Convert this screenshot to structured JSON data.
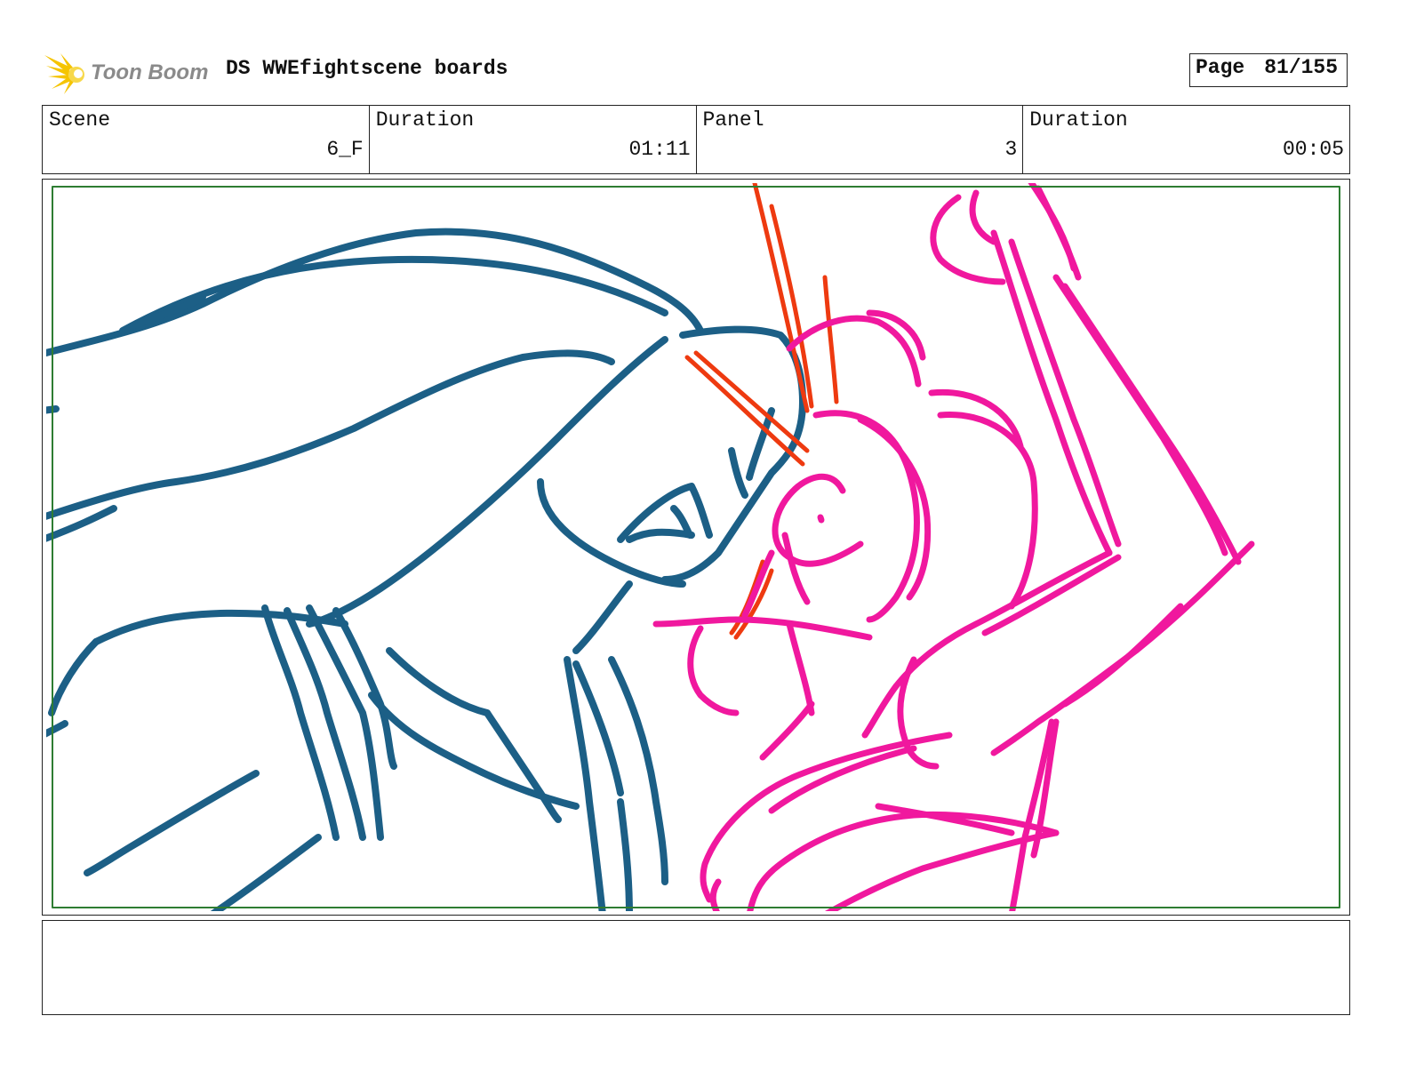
{
  "header": {
    "logo_text": "Toon Boom",
    "board_title": "DS WWEfightscene boards",
    "page_label": "Page",
    "page_value": "81/155"
  },
  "info": {
    "scene_label": "Scene",
    "scene_value": "6_F",
    "scene_duration_label": "Duration",
    "scene_duration_value": "01:11",
    "panel_label": "Panel",
    "panel_value": "3",
    "panel_duration_label": "Duration",
    "panel_duration_value": "00:05"
  },
  "colors": {
    "teal_sketch": "#1c5f86",
    "pink_sketch": "#f0189e",
    "orange_sketch": "#ee3a10",
    "safe_frame": "#2e7d32",
    "logo_star": "#f5c400"
  },
  "icons": {
    "logo": "toon-boom-star-icon"
  },
  "notes": {
    "text": ""
  }
}
